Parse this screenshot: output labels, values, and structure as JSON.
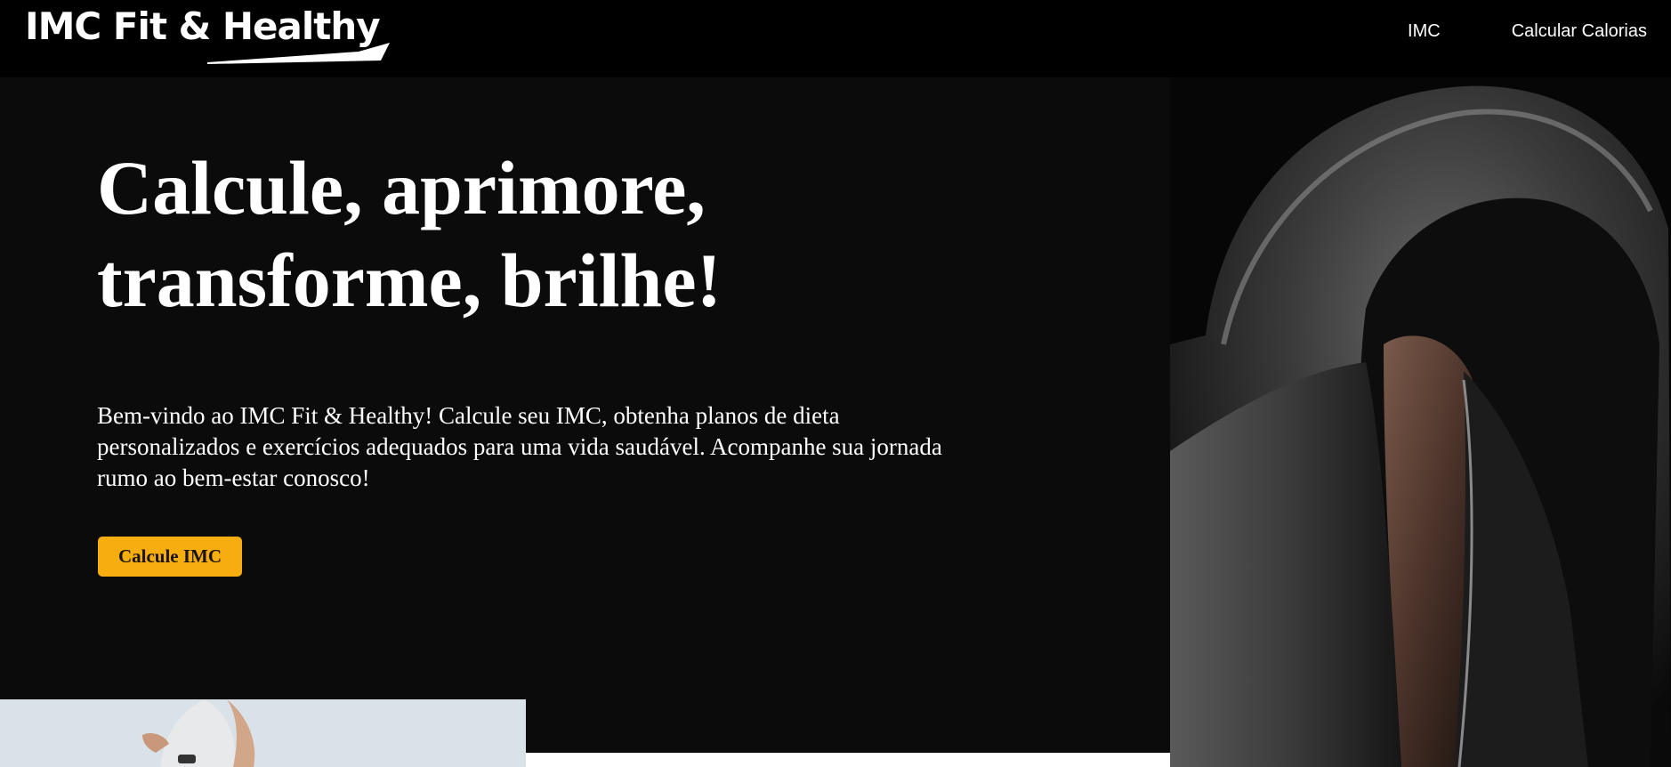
{
  "header": {
    "logo_text": "IMC Fit & Healthy",
    "nav": {
      "imc_label": "IMC",
      "calories_label": "Calcular Calorias"
    }
  },
  "hero": {
    "title": "Calcule, aprimore, transforme, brilhe!",
    "description": "Bem-vindo ao IMC Fit & Healthy! Calcule seu IMC, obtenha planos de dieta personalizados e exercícios adequados para uma vida saudável. Acompanhe sua jornada rumo ao bem-estar conosco!",
    "cta_label": "Calcule IMC"
  },
  "images": {
    "hero_photo": "hooded-man-icon",
    "bottom_photo": "woman-exercising-icon"
  },
  "colors": {
    "background": "#0b0b0b",
    "header": "#000000",
    "accent": "#f5ad0f",
    "text": "#ffffff"
  }
}
